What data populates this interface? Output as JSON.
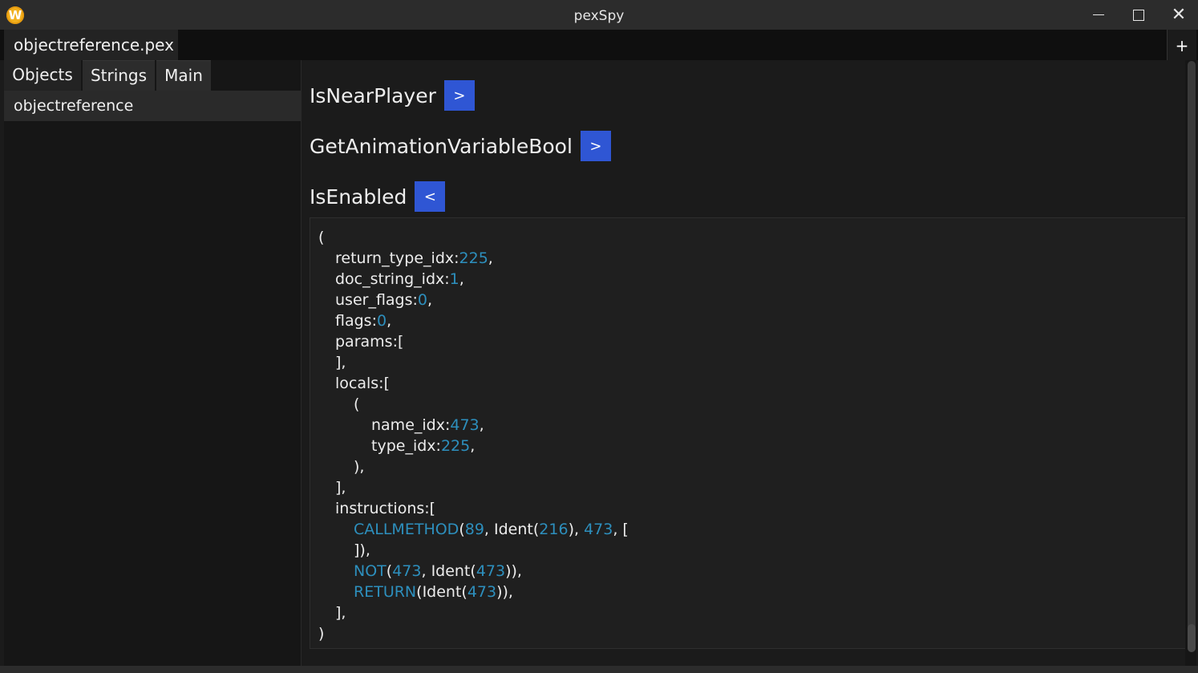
{
  "window": {
    "title": "pexSpy",
    "app_icon_letter": "W",
    "app_icon_color": "#f2b01e",
    "minimize_icon": "minimize-icon",
    "maximize_icon": "maximize-icon",
    "close_icon": "close-icon"
  },
  "tabs": {
    "file_tab_label": "objectreference.pex",
    "add_tab_label": "+"
  },
  "sidebar": {
    "tabs": [
      {
        "label": "Objects"
      },
      {
        "label": "Strings"
      },
      {
        "label": "Main"
      }
    ],
    "items": [
      {
        "label": "objectreference"
      }
    ]
  },
  "functions": [
    {
      "name": "IsNearPlayer",
      "toggle": ">"
    },
    {
      "name": "GetAnimationVariableBool",
      "toggle": ">"
    },
    {
      "name": "IsEnabled",
      "toggle": "<"
    }
  ],
  "code": {
    "open_paren": "(",
    "return_type_key": "return_type_idx:",
    "return_type_val": "225",
    "doc_string_key": "doc_string_idx:",
    "doc_string_val": "1",
    "user_flags_key": "user_flags:",
    "user_flags_val": "0",
    "flags_key": "flags:",
    "flags_val": "0",
    "params_open": "params:[",
    "params_close": "],",
    "locals_open": "locals:[",
    "local_open": "(",
    "name_idx_key": "name_idx:",
    "name_idx_val": "473",
    "type_idx_key": "type_idx:",
    "type_idx_val": "225",
    "local_close": "),",
    "locals_close": "],",
    "instructions_open": "instructions:[",
    "callmethod": "CALLMETHOD",
    "call_arg1": "89",
    "call_arg_ident": "216",
    "call_arg3": "473",
    "call_close": "]),",
    "not": "NOT",
    "not_arg1": "473",
    "not_ident": "473",
    "ret": "RETURN",
    "ret_ident": "473",
    "instructions_close": "],",
    "close_paren": ")",
    "ident_word": "Ident"
  },
  "colors": {
    "accent_button": "#2f56d4",
    "number_color": "#2d8fbd"
  }
}
